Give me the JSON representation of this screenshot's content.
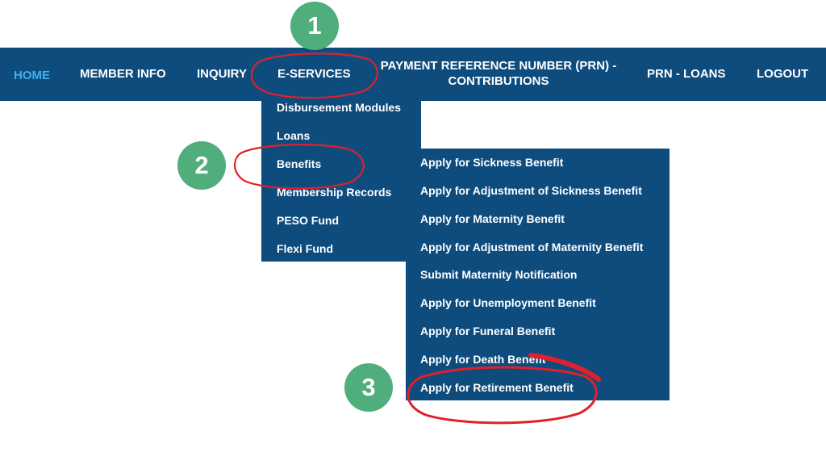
{
  "colors": {
    "nav_background": "#0f4c7e",
    "nav_text": "#ffffff",
    "nav_active_text": "#3fb0ef",
    "step_badge": "#4fae7b",
    "annotation_circle": "#e0202a"
  },
  "nav": {
    "home": "HOME",
    "member_info": "MEMBER INFO",
    "inquiry": "INQUIRY",
    "e_services": "E-SERVICES",
    "prn_line1": "PAYMENT REFERENCE NUMBER (PRN) -",
    "prn_line2": "CONTRIBUTIONS",
    "prn_loans": "PRN - LOANS",
    "logout": "LOGOUT"
  },
  "eservices_menu": {
    "items": [
      "Disbursement Modules",
      "Loans",
      "Benefits",
      "Membership Records",
      "PESO Fund",
      "Flexi Fund"
    ]
  },
  "benefits_menu": {
    "items": [
      "Apply for Sickness Benefit",
      "Apply for Adjustment of Sickness Benefit",
      "Apply for Maternity Benefit",
      "Apply for Adjustment of Maternity Benefit",
      "Submit Maternity Notification",
      "Apply for Unemployment Benefit",
      "Apply for Funeral Benefit",
      "Apply for Death Benefit",
      "Apply for Retirement Benefit"
    ]
  },
  "steps": {
    "step1": "1",
    "step2": "2",
    "step3": "3"
  }
}
